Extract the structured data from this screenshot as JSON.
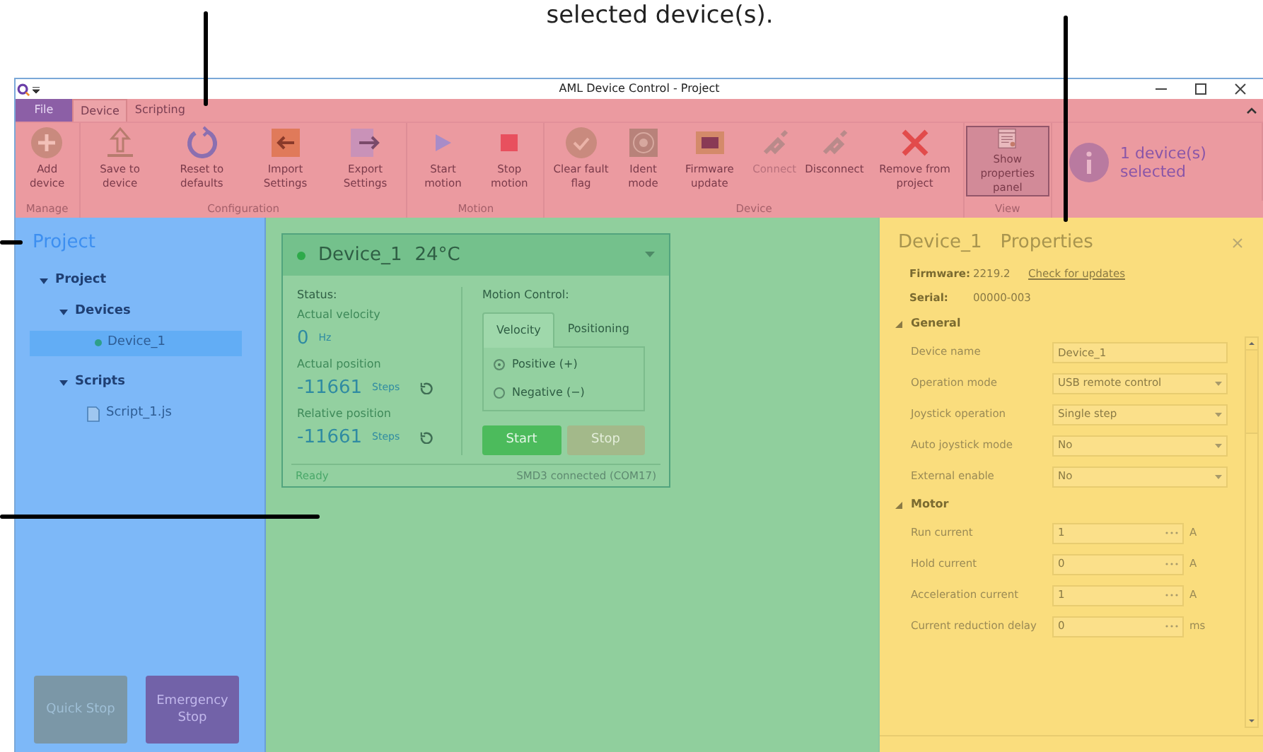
{
  "caption": "selected device(s).",
  "window": {
    "title": "AML Device Control - Project"
  },
  "ribbon": {
    "tabs": [
      {
        "label": "File",
        "kind": "file",
        "selected": false
      },
      {
        "label": "Device",
        "kind": "tab",
        "selected": true
      },
      {
        "label": "Scripting",
        "kind": "tab",
        "selected": false
      }
    ],
    "groups": [
      {
        "label": "Manage",
        "buttons": [
          {
            "label": "Add device",
            "kind": "add",
            "disabled": false,
            "selected": false
          }
        ]
      },
      {
        "label": "Configuration",
        "buttons": [
          {
            "label": "Save to device",
            "kind": "upload",
            "disabled": false,
            "selected": false
          },
          {
            "label": "Reset to defaults",
            "kind": "reset",
            "disabled": false,
            "selected": false
          },
          {
            "label": "Import Settings",
            "kind": "import",
            "disabled": false,
            "selected": false
          },
          {
            "label": "Export Settings",
            "kind": "export",
            "disabled": false,
            "selected": false
          }
        ]
      },
      {
        "label": "Motion",
        "buttons": [
          {
            "label": "Start motion",
            "kind": "play",
            "disabled": false,
            "selected": false
          },
          {
            "label": "Stop motion",
            "kind": "stop",
            "disabled": false,
            "selected": false
          }
        ]
      },
      {
        "label": "Device",
        "buttons": [
          {
            "label": "Clear fault flag",
            "kind": "check",
            "disabled": false,
            "selected": false
          },
          {
            "label": "Ident mode",
            "kind": "target",
            "disabled": false,
            "selected": false
          },
          {
            "label": "Firmware update",
            "kind": "chip",
            "disabled": false,
            "selected": false
          },
          {
            "label": "Connect",
            "kind": "plug",
            "disabled": true,
            "selected": false
          },
          {
            "label": "Disconnect",
            "kind": "plug",
            "disabled": false,
            "selected": false
          },
          {
            "label": "Remove from project",
            "kind": "remove",
            "disabled": false,
            "selected": false
          }
        ]
      },
      {
        "label": "View",
        "buttons": [
          {
            "label": "Show properties panel",
            "kind": "panel",
            "disabled": false,
            "selected": true
          }
        ]
      }
    ],
    "selection_info": "1 device(s) selected"
  },
  "project_panel": {
    "title": "Project",
    "tree": [
      {
        "label": "Project",
        "kind": "folder",
        "expanded": true,
        "selected": false,
        "children": [
          {
            "label": "Devices",
            "kind": "folder",
            "expanded": true,
            "selected": false,
            "children": [
              {
                "label": "Device_1",
                "kind": "device",
                "selected": true
              }
            ]
          },
          {
            "label": "Scripts",
            "kind": "folder",
            "expanded": true,
            "selected": false,
            "children": [
              {
                "label": "Script_1.js",
                "kind": "script",
                "selected": false
              }
            ]
          }
        ]
      }
    ],
    "buttons": [
      {
        "label": "Quick Stop",
        "disabled": true
      },
      {
        "label": "Emergency Stop",
        "disabled": false
      }
    ]
  },
  "device_card": {
    "name": "Device_1",
    "temperature": "24°C",
    "status_heading": "Status:",
    "readings": [
      {
        "label": "Actual velocity",
        "value": "0",
        "unit": "Hz",
        "resettable": false
      },
      {
        "label": "Actual position",
        "value": "-11661",
        "unit": "Steps",
        "resettable": true
      },
      {
        "label": "Relative position",
        "value": "-11661",
        "unit": "Steps",
        "resettable": true
      }
    ],
    "motion_heading": "Motion Control:",
    "tabs": [
      {
        "label": "Velocity",
        "selected": true
      },
      {
        "label": "Positioning",
        "selected": false
      }
    ],
    "directions": [
      {
        "label": "Positive (+)",
        "selected": true
      },
      {
        "label": "Negative (−)",
        "selected": false
      }
    ],
    "buttons": [
      {
        "label": "Start",
        "disabled": false
      },
      {
        "label": "Stop",
        "disabled": true
      }
    ],
    "status": "Ready",
    "connection": "SMD3 connected (COM17)"
  },
  "properties": {
    "device": "Device_1",
    "title": "Properties",
    "info": [
      {
        "label": "Firmware:",
        "value": "2219.2",
        "link": "Check for updates"
      },
      {
        "label": "Serial:",
        "value": "00000-003"
      }
    ],
    "sections": [
      {
        "title": "General",
        "expanded": true,
        "rows": [
          {
            "label": "Device name",
            "kind": "text",
            "value": "Device_1"
          },
          {
            "label": "Operation mode",
            "kind": "select",
            "value": "USB remote control"
          },
          {
            "label": "Joystick operation",
            "kind": "select",
            "value": "Single step"
          },
          {
            "label": "Auto joystick mode",
            "kind": "select",
            "value": "No"
          },
          {
            "label": "External enable",
            "kind": "select",
            "value": "No"
          }
        ]
      },
      {
        "title": "Motor",
        "expanded": true,
        "rows": [
          {
            "label": "Run current",
            "kind": "number",
            "value": "1",
            "unit": "A"
          },
          {
            "label": "Hold current",
            "kind": "number",
            "value": "0",
            "unit": "A"
          },
          {
            "label": "Acceleration current",
            "kind": "number",
            "value": "1",
            "unit": "A"
          },
          {
            "label": "Current reduction delay",
            "kind": "number",
            "value": "0",
            "unit": "ms"
          }
        ]
      }
    ]
  }
}
